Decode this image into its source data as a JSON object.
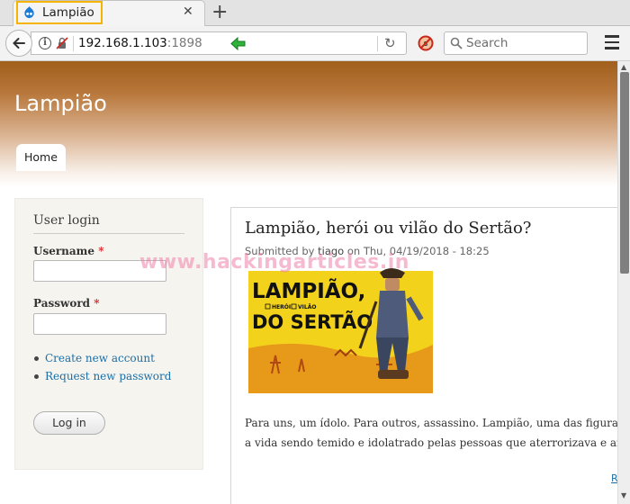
{
  "browser": {
    "tab_title": "Lampião",
    "url_host": "192.168.1.103",
    "url_port": ":1898",
    "search_placeholder": "Search"
  },
  "site": {
    "name": "Lampião",
    "nav": [
      "Home"
    ]
  },
  "login_block": {
    "title": "User login",
    "username_label": "Username",
    "password_label": "Password",
    "required_marker": "*",
    "links": [
      "Create new account",
      "Request new password"
    ],
    "login_button": "Log in"
  },
  "article": {
    "title": "Lampião, herói ou vilão do Sertão?",
    "submitted_prefix": "Submitted by",
    "author": "tiago",
    "submitted_on": "on Thu, 04/19/2018 - 18:25",
    "poster_text": [
      "LAMPIÃO,",
      "HERÓI",
      "VILÃO",
      "DO SERTÃO"
    ],
    "body_lines": [
      "Para uns, um ídolo. Para outros, assassino. Lampião, uma das figuras mai",
      "a vida sendo temido e idolatrado pelas pessoas que aterrorizava e amparav"
    ],
    "readmore": "R"
  },
  "watermark": "www.hackingarticles.in",
  "colors": {
    "header_top": "#a15f1c",
    "link": "#1a6ea7",
    "required": "#e0252b",
    "poster_yellow": "#f2d21b"
  }
}
